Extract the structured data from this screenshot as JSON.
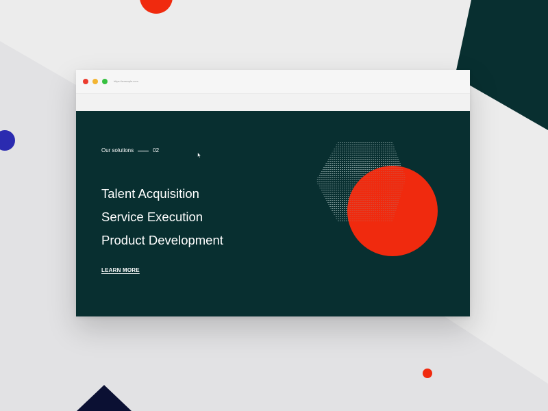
{
  "browser": {
    "url": "https://example.com"
  },
  "hero": {
    "eyebrow_label": "Our solutions",
    "eyebrow_number": "02",
    "solutions": [
      "Talent Acquisition",
      "Service Execution",
      "Product Development"
    ],
    "cta_label": "LEARN MORE"
  },
  "colors": {
    "background": "#ececec",
    "dark_teal": "#082f30",
    "accent_red": "#f02a0e",
    "accent_blue": "#2b2bb0",
    "navy": "#0b1033",
    "white": "#ffffff"
  },
  "icons": {
    "cursor": "arrow-cursor-icon",
    "traffic_lights": [
      "close-dot-icon",
      "minimize-dot-icon",
      "maximize-dot-icon"
    ]
  }
}
